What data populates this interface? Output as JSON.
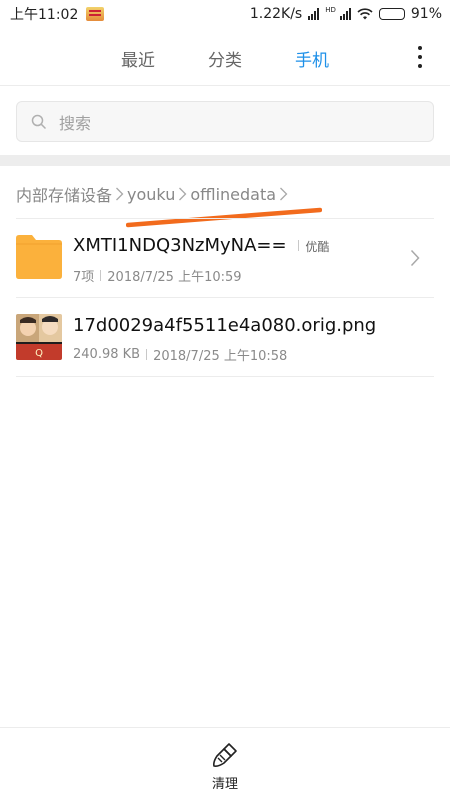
{
  "status_bar": {
    "time": "上午11:02",
    "network_speed": "1.22K/s",
    "network_badge": "HD",
    "battery": "91%",
    "battery_level": 0.91,
    "icons": [
      "notification-icon",
      "signal-icon",
      "wifi-icon",
      "battery-icon"
    ]
  },
  "tabs": [
    {
      "label": "最近",
      "active": false
    },
    {
      "label": "分类",
      "active": false
    },
    {
      "label": "手机",
      "active": true
    }
  ],
  "colors": {
    "accent": "#1e90e8",
    "folder": "#fbb13c",
    "annotation": "#f26b1d"
  },
  "search": {
    "placeholder": "搜索",
    "value": ""
  },
  "breadcrumb": [
    "内部存储设备",
    "youku",
    "offlinedata"
  ],
  "files": [
    {
      "type": "folder",
      "name": "XMTI1NDQ3NzMyNA==",
      "tag": "优酷",
      "count": "7项",
      "modified": "2018/7/25 上午10:59",
      "icon": "folder-icon"
    },
    {
      "type": "image",
      "name": "17d0029a4f5511e4a080.orig.png",
      "size": "240.98 KB",
      "modified": "2018/7/25 上午10:58",
      "icon": "image-thumbnail"
    }
  ],
  "bottom_bar": {
    "clean_label": "清理",
    "icon": "broom-icon"
  }
}
